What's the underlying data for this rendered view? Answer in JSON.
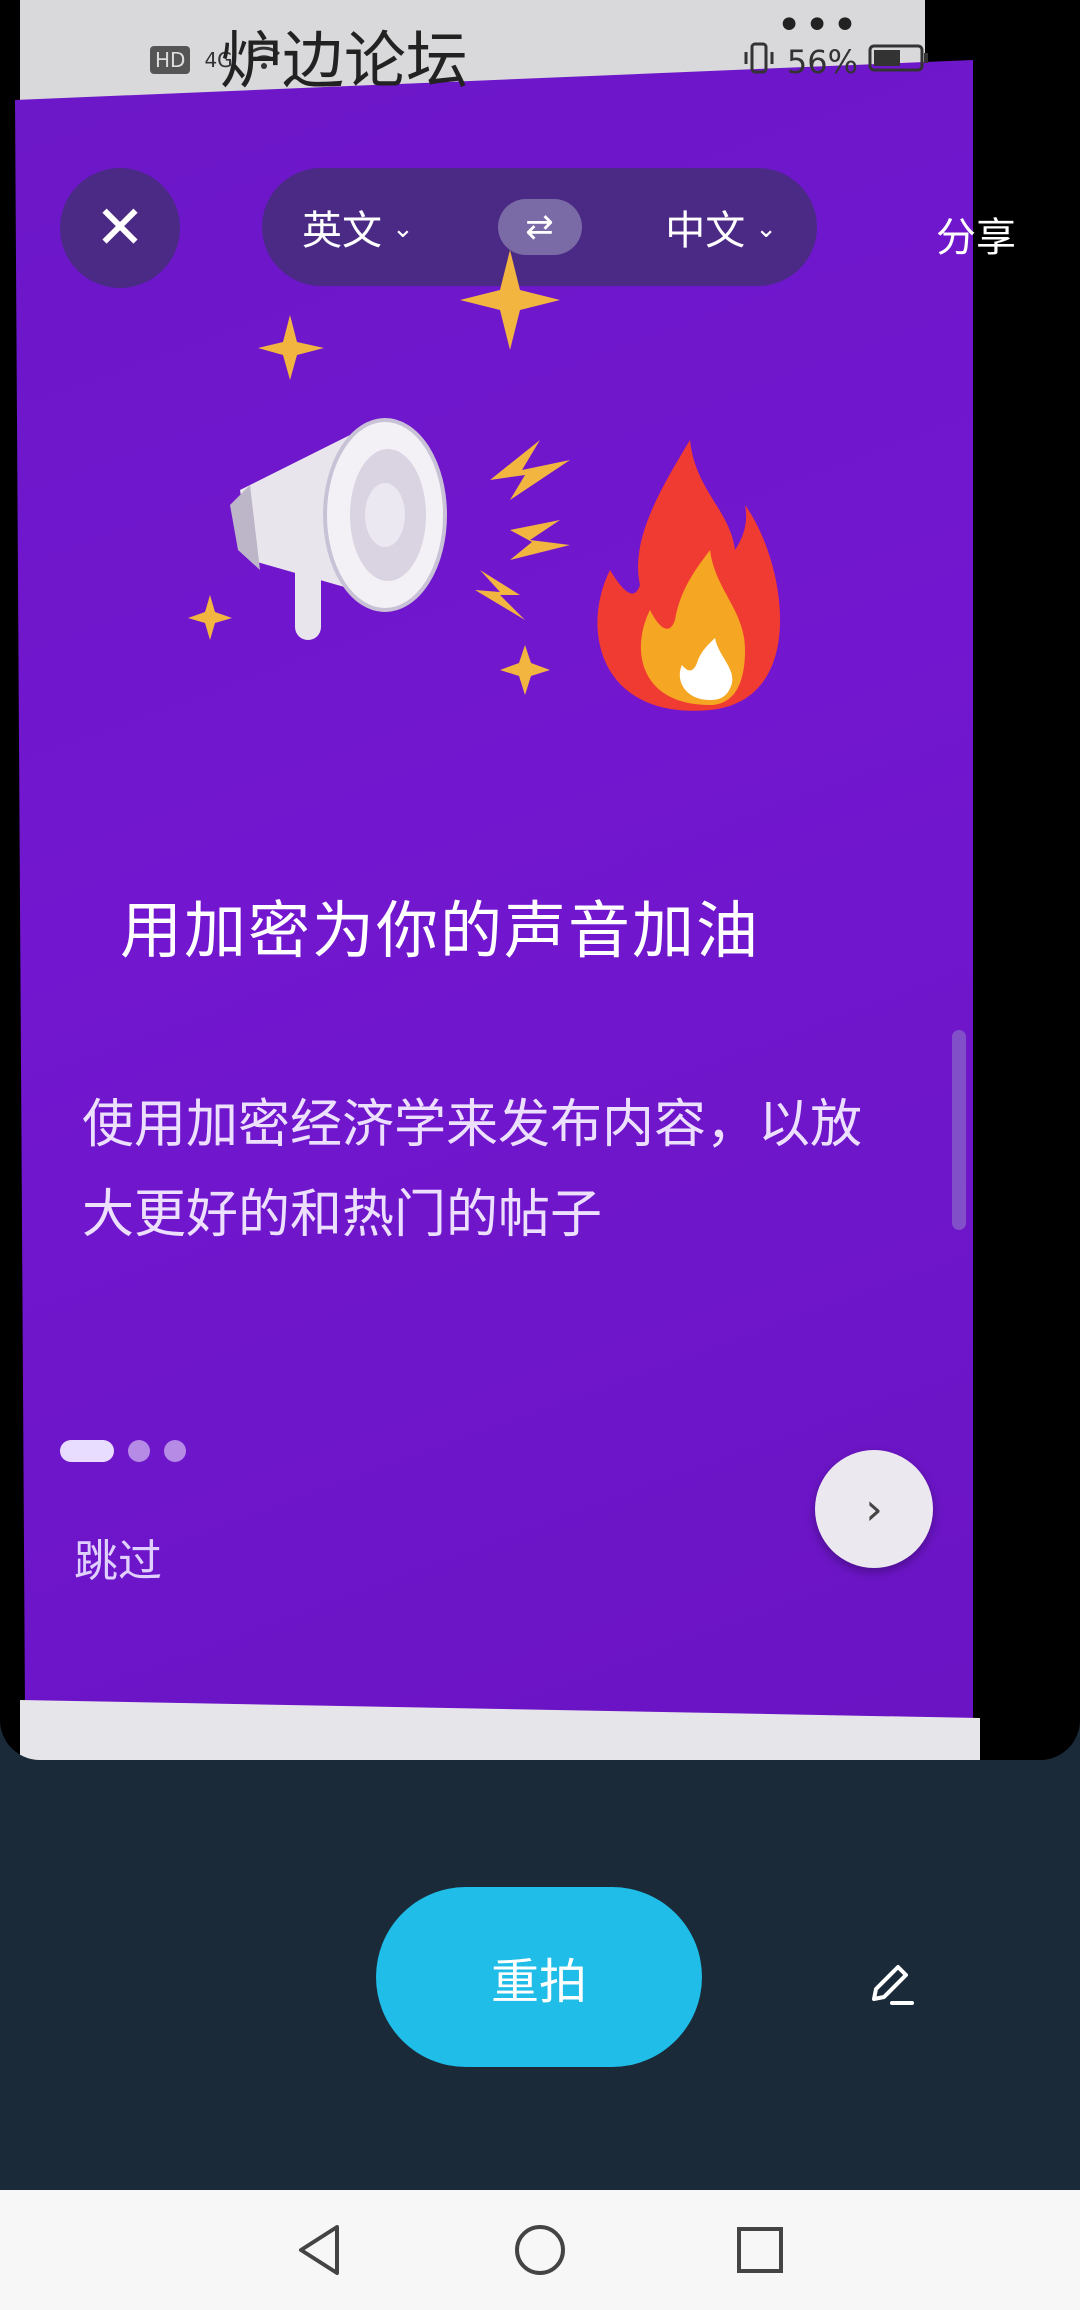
{
  "overlay": {
    "title": "炉边论坛",
    "menu_glyph": "•••"
  },
  "status_bar": {
    "left_icons": [
      "hd-icon",
      "signal-4g-icon",
      "wifi-icon"
    ],
    "hd_label": "HD",
    "net_label": "4G",
    "battery_percent": "56%"
  },
  "translate_bar": {
    "source_lang": "英文",
    "target_lang": "中文",
    "swap_glyph": "⇄",
    "chevron_glyph": "⌄",
    "share_label": "分享",
    "close_glyph": "✕"
  },
  "content": {
    "headline": "用加密为你的声音加油",
    "subtext": "使用加密经济学来发布内容，以放大更好的和热门的帖子",
    "skip_label": "跳过",
    "next_glyph": "›",
    "pager": {
      "count": 3,
      "active_index": 0
    }
  },
  "bottom_actions": {
    "retake_label": "重拍"
  },
  "colors": {
    "screen_purple": "#6c17c8",
    "retake_blue": "#1fbde8",
    "panel_dark": "#1a2a38"
  }
}
